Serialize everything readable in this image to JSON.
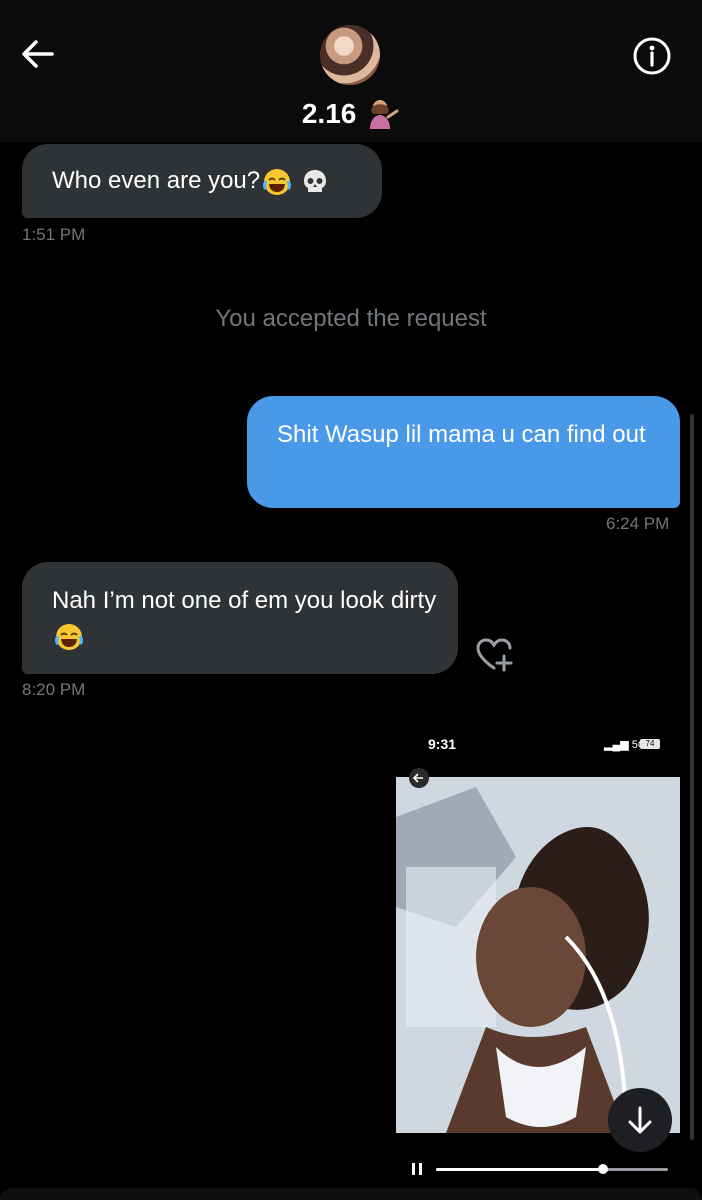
{
  "header": {
    "title": "2.16",
    "title_emoji": "person-tipping-hand-emoji"
  },
  "messages": [
    {
      "direction": "incoming",
      "text": "Who even are you?",
      "emojis": [
        "face-with-tears-of-joy-emoji",
        "skull-emoji"
      ],
      "time": "1:51 PM"
    },
    {
      "direction": "outgoing",
      "text": "Shit Wasup lil mama u can find out",
      "time": "6:24 PM"
    },
    {
      "direction": "incoming",
      "text": "Nah I’m not one of em you look dirty",
      "emojis": [
        "face-with-tears-of-joy-emoji"
      ],
      "time": "8:20 PM"
    }
  ],
  "system_message": "You accepted the request",
  "media": {
    "status_time": "9:31",
    "network": "5G",
    "battery": "74",
    "video_progress": 0.72
  },
  "icons": {
    "back": "arrow-left-icon",
    "info": "info-icon",
    "like": "heart-plus-icon",
    "download": "arrow-down-icon",
    "pause": "pause-icon"
  },
  "colors": {
    "incoming_bubble": "#2f3336",
    "outgoing_bubble": "#4a99e9",
    "timestamp": "#71767b"
  }
}
